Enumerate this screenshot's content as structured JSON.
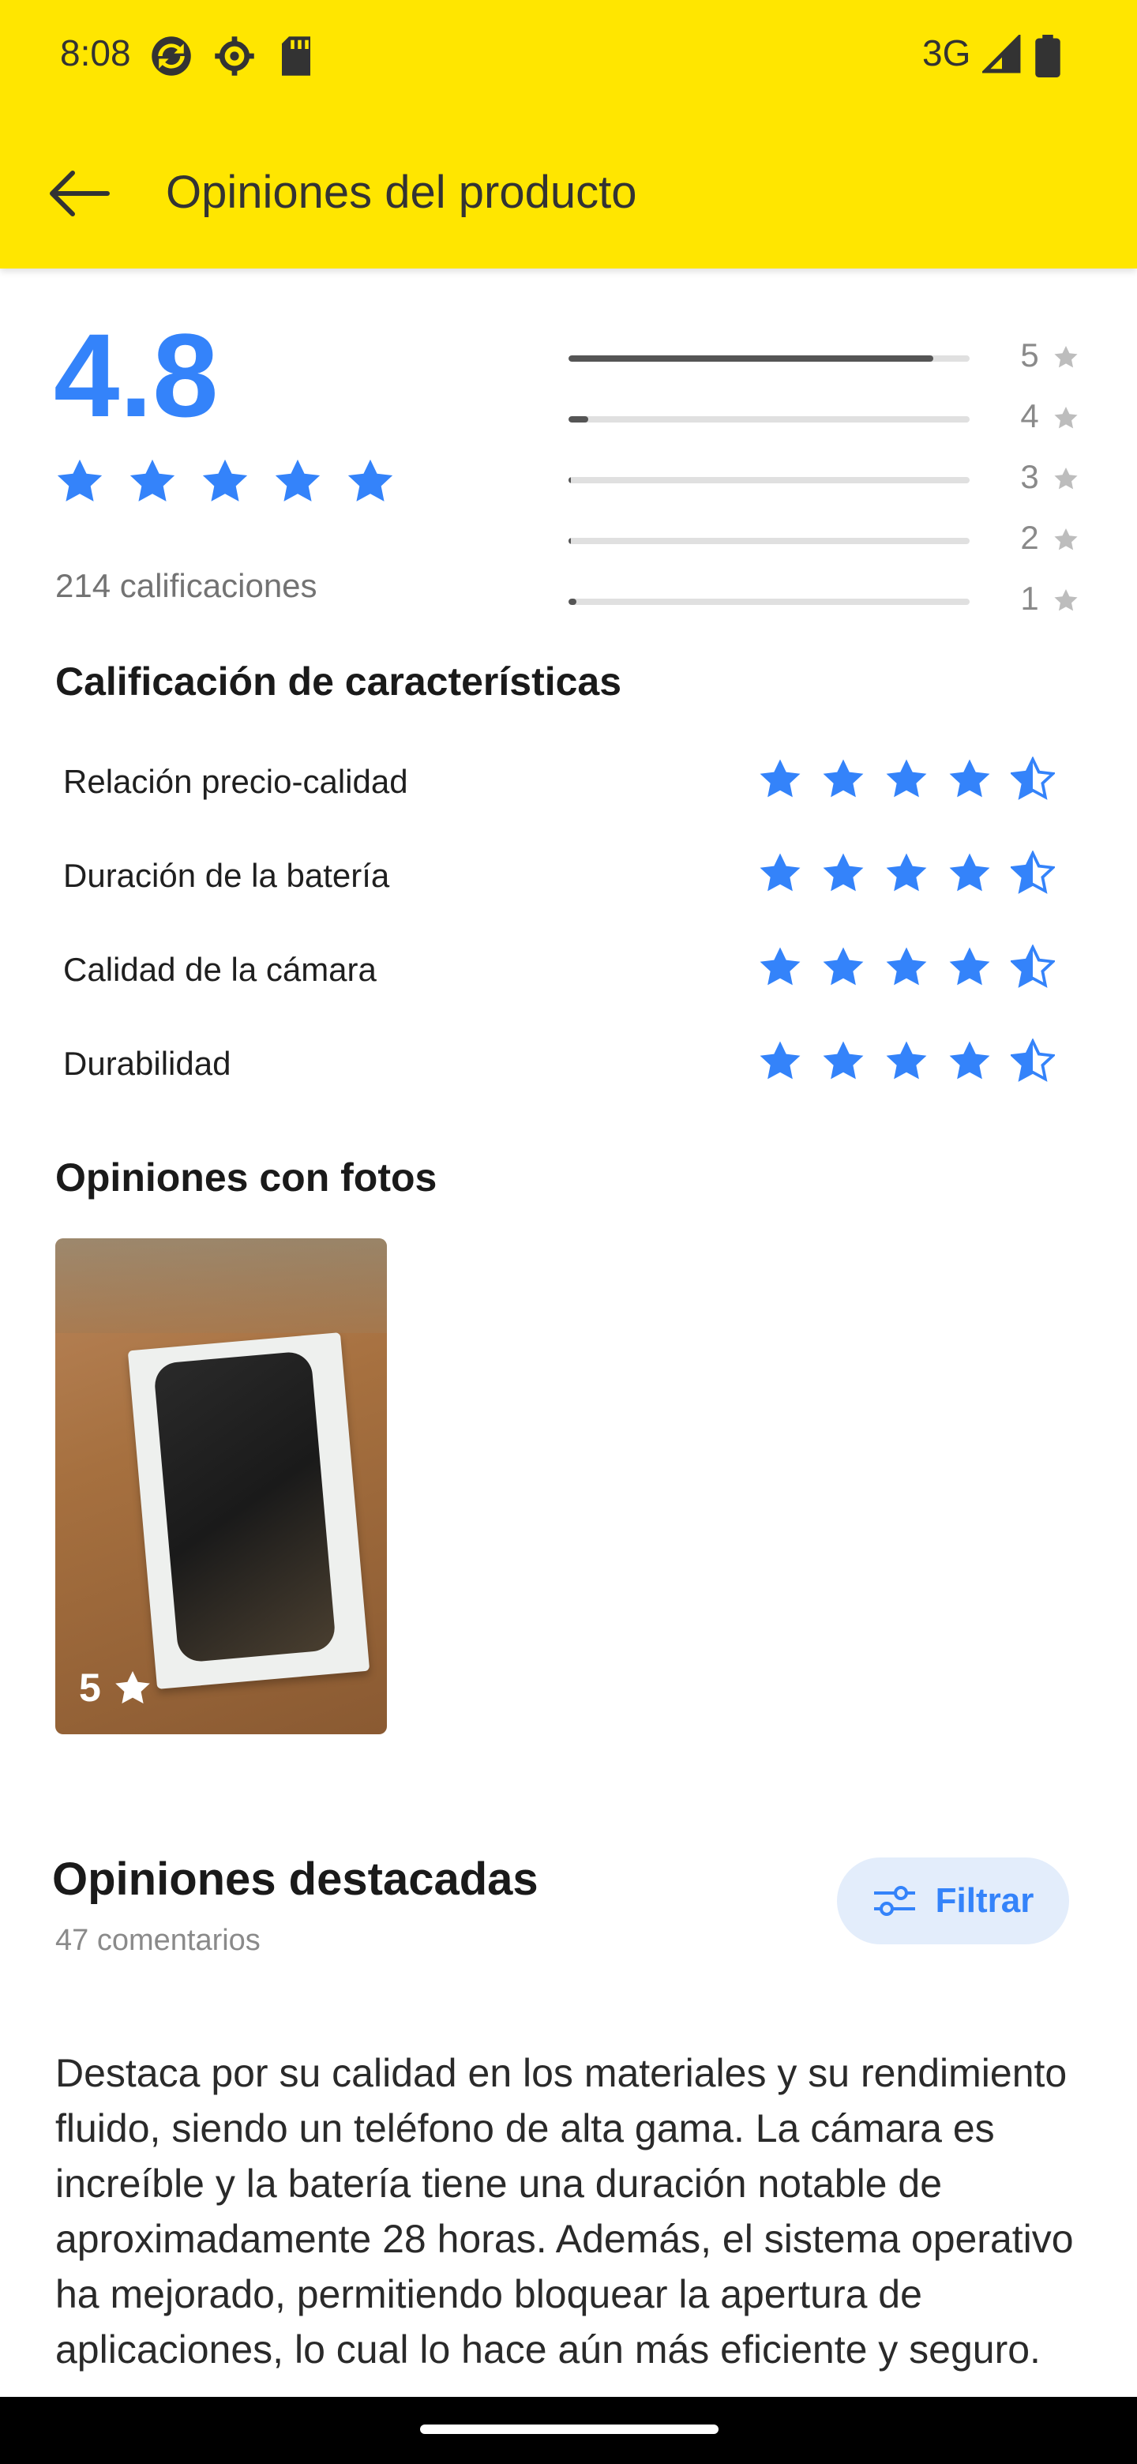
{
  "status_bar": {
    "time": "8:08",
    "network": "3G"
  },
  "app_bar": {
    "title": "Opiniones del producto"
  },
  "summary": {
    "average": "4.8",
    "ratings_count": "214 calificaciones",
    "distribution": [
      {
        "label": "5",
        "fraction": 0.91
      },
      {
        "label": "4",
        "fraction": 0.05
      },
      {
        "label": "3",
        "fraction": 0.005
      },
      {
        "label": "2",
        "fraction": 0.005
      },
      {
        "label": "1",
        "fraction": 0.02
      }
    ]
  },
  "characteristics": {
    "title": "Calificación de características",
    "items": [
      {
        "label": "Relación precio-calidad",
        "rating": 4.5
      },
      {
        "label": "Duración de la batería",
        "rating": 4.5
      },
      {
        "label": "Calidad de la cámara",
        "rating": 4.5
      },
      {
        "label": "Durabilidad",
        "rating": 4.5
      }
    ]
  },
  "photos": {
    "title": "Opiniones con fotos",
    "items": [
      {
        "rating": "5"
      }
    ]
  },
  "featured": {
    "title": "Opiniones destacadas",
    "count": "47 comentarios",
    "filter_label": "Filtrar",
    "review_text": "Destaca por su calidad en los materiales y su rendimiento fluido, siendo un teléfono de alta gama. La cámara es increíble y la batería tiene una duración notable de aproximadamente 28 horas. Además, el sistema operativo ha mejorado, permitiendo bloquear la apertura de aplicaciones, lo cual lo hace aún más eficiente y seguro."
  },
  "colors": {
    "accent": "#3483fa",
    "header": "#ffe600"
  },
  "icons": [
    "back-arrow-icon",
    "sync-icon",
    "settings-icon",
    "sd-card-icon",
    "signal-icon",
    "battery-icon",
    "star-icon",
    "filter-icon"
  ]
}
